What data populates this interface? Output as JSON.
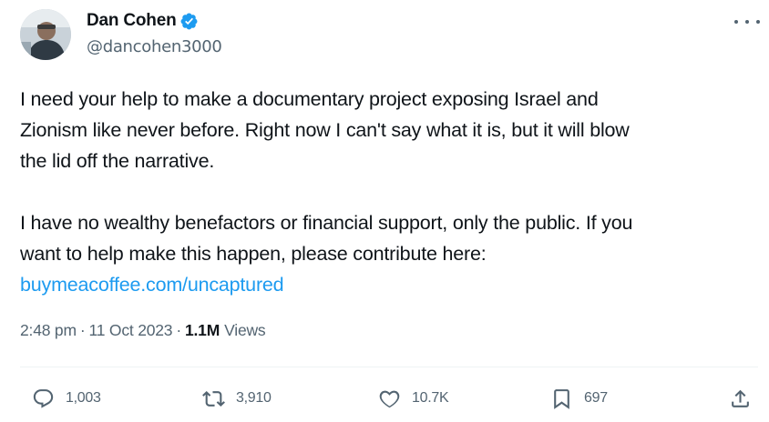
{
  "author": {
    "display_name": "Dan Cohen",
    "handle": "@dancohen3000",
    "icons": {
      "avatar": "profile-photo",
      "verified": "verified-badge-icon",
      "more": "more-options-icon"
    },
    "verified_color": "#1d9bf0"
  },
  "tweet": {
    "paragraphs": [
      [
        "I need your help to make a documentary project exposing Israel and",
        "Zionism like never before. Right now I can't say what it is, but it will blow",
        "the lid off the narrative."
      ],
      [
        "I have no wealthy benefactors or financial support, only the public. If you",
        "want to help make this happen, please contribute here:"
      ]
    ],
    "link": "buymeacoffee.com/uncaptured",
    "link_color": "#1d9bf0"
  },
  "meta": {
    "time": "2:48 pm",
    "separator": "·",
    "date": "11 Oct 2023",
    "views_count": "1.1M",
    "views_label": "Views"
  },
  "actions": {
    "reply": {
      "icon": "reply-icon",
      "count": "1,003"
    },
    "retweet": {
      "icon": "retweet-icon",
      "count": "3,910"
    },
    "like": {
      "icon": "heart-icon",
      "count": "10.7K"
    },
    "bookmark": {
      "icon": "bookmark-icon",
      "count": "697"
    },
    "share": {
      "icon": "share-icon"
    }
  },
  "colors": {
    "text": "#0f1419",
    "secondary": "#536471",
    "divider": "#eff3f4"
  }
}
